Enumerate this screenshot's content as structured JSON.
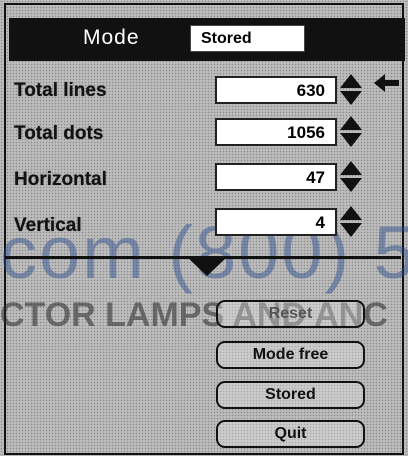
{
  "mode": {
    "label": "Mode",
    "value": "Stored"
  },
  "rows": [
    {
      "label": "Total lines",
      "value": "630"
    },
    {
      "label": "Total dots",
      "value": "1056"
    },
    {
      "label": "Horizontal",
      "value": "47"
    },
    {
      "label": "Vertical",
      "value": "4"
    }
  ],
  "buttons": {
    "reset": "Reset",
    "mode_free": "Mode free",
    "stored": "Stored",
    "quit": "Quit"
  },
  "watermark": {
    "line1": "com (800) 5",
    "line2": "CTOR LAMPS AND ANC"
  },
  "icons": {
    "pointer": "left-arrow-icon",
    "spin": "up-down-spinner-icon",
    "expand": "triangle-down-icon"
  }
}
